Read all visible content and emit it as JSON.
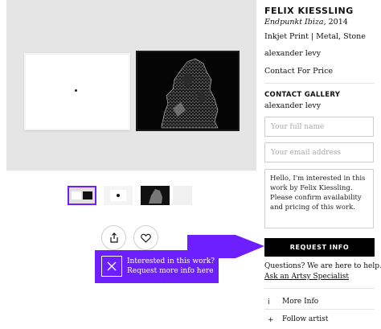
{
  "artwork": {
    "artist": "FELIX KIESSLING",
    "title": "Endpunkt Ibiza",
    "year": ", 2014",
    "medium": "Inkjet Print | Metal, Stone",
    "gallery": "alexander levy",
    "price": "Contact For Price"
  },
  "contact": {
    "heading": "CONTACT GALLERY",
    "gallery": "alexander levy",
    "name_placeholder": "Your full name",
    "email_placeholder": "Your email address",
    "message": "Hello, I'm interested in this work by Felix Kiessling. Please confirm availability and pricing of this work.",
    "request_button": "REQUEST INFO",
    "questions": "Questions? We are here to help.",
    "specialist_link": "Ask an Artsy Specialist"
  },
  "actions": {
    "more_info": "More Info",
    "follow": "Follow artist"
  },
  "callout": {
    "line1": "Interested in this work?",
    "line2": "Request more info here"
  },
  "colors": {
    "accent": "#6e1fff",
    "button": "#000000",
    "hero_bg": "#e5e5e5"
  },
  "icons": [
    "share-icon",
    "heart-icon",
    "close-icon",
    "info-icon",
    "plus-icon"
  ]
}
